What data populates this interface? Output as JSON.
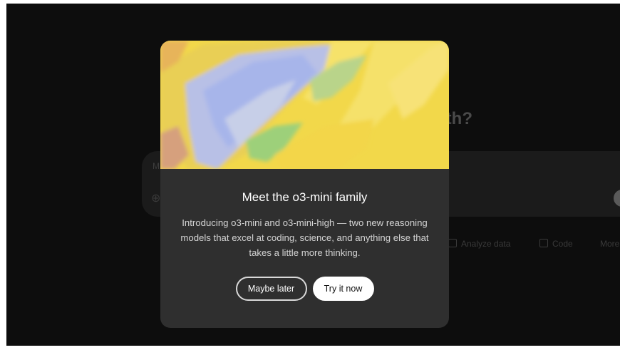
{
  "background": {
    "heading_fragment": "ith?",
    "composer_label": "M",
    "action_chips": [
      "Analyze data",
      "Code",
      "More"
    ],
    "icons": [
      "attach-icon",
      "voice-icon"
    ]
  },
  "modal": {
    "title": "Meet the o3-mini family",
    "body": "Introducing o3-mini and o3-mini-high — two new reasoning models that excel at coding, science, and anything else that takes a little more thinking.",
    "secondary_button": "Maybe later",
    "primary_button": "Try it now"
  },
  "colors": {
    "page_background": "#0d0d0d",
    "modal_background": "#2f2f2f",
    "hero_yellow": "#f2d84a",
    "hero_blue": "#a8b8e8",
    "primary_button_bg": "#ffffff"
  }
}
